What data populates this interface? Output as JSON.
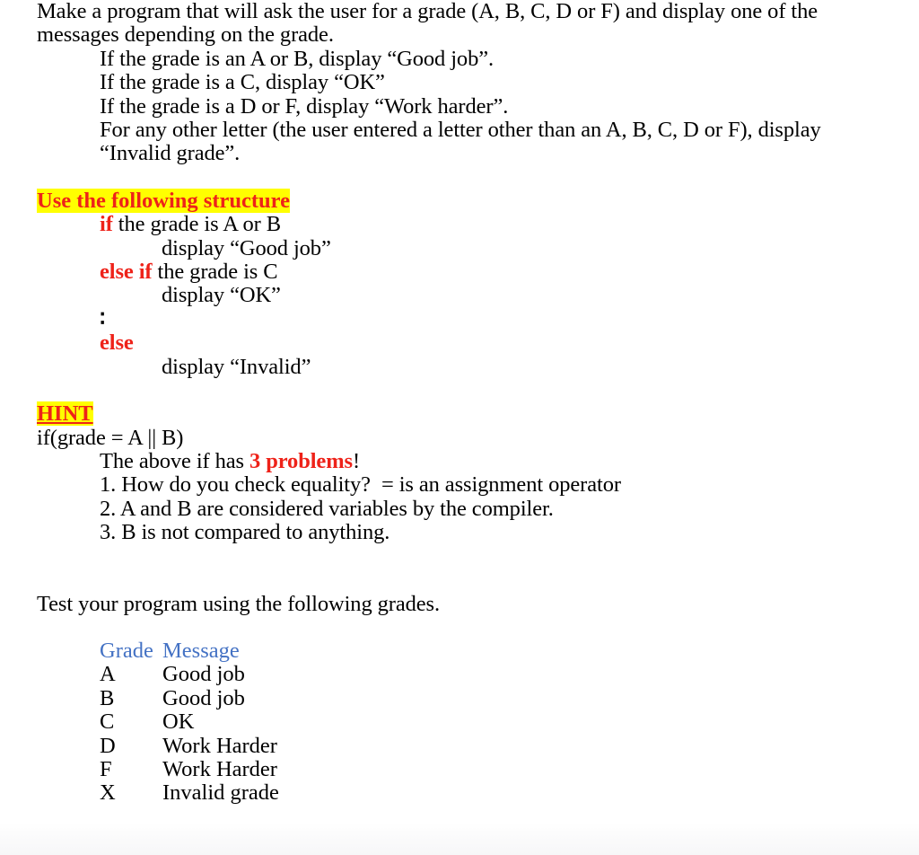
{
  "document": {
    "intro": {
      "paragraph": "Make a program that will ask the user for a grade (A, B, C, D or F) and display one of the messages depending on the grade.",
      "bullets": [
        "If the grade is an A or B, display “Good job”.",
        "If the grade is a C, display “OK”",
        "If the grade is a D or F, display “Work harder”.",
        "For any other letter (the user entered a letter other than an A, B, C, D or F), display “Invalid grade”."
      ]
    },
    "structure_section": {
      "heading": "Use the following structure",
      "heading_highlight_color": "#ffff00",
      "heading_text_color": "#ee2219",
      "lines": [
        {
          "keyword": "if",
          "rest": " the grade is A or B",
          "indent": 1
        },
        {
          "keyword": "",
          "rest": "display “Good job”",
          "indent": 2
        },
        {
          "keyword": "else if",
          "rest": " the grade is C",
          "indent": 1
        },
        {
          "keyword": "",
          "rest": "display “OK”",
          "indent": 2
        },
        {
          "keyword": "",
          "rest": "∶",
          "indent": 1
        },
        {
          "keyword": "else",
          "rest": "",
          "indent": 1
        },
        {
          "keyword": "",
          "rest": "display “Invalid”",
          "indent": 2
        }
      ]
    },
    "hint_section": {
      "heading": "HINT",
      "heading_highlight_color": "#ffff00",
      "heading_text_color": "#ee2219",
      "code_line": "if(grade = A || B)",
      "problems_lead_before": "The above if has ",
      "problems_emphasis": "3 problems",
      "problems_lead_after": "!",
      "problems": [
        "1. How do you check equality?  = is an assignment operator",
        "2. A and B are considered variables by the compiler.",
        "3. B is not compared to anything."
      ]
    },
    "test_section": {
      "instruction": "Test your program using the following grades.",
      "table": {
        "header_color": "#4472c4",
        "columns": [
          "Grade",
          "Message"
        ],
        "rows": [
          [
            "A",
            "Good job"
          ],
          [
            "B",
            "Good job"
          ],
          [
            "C",
            "OK"
          ],
          [
            "D",
            "Work Harder"
          ],
          [
            "F",
            "Work Harder"
          ],
          [
            "X",
            "Invalid grade"
          ]
        ]
      }
    }
  }
}
